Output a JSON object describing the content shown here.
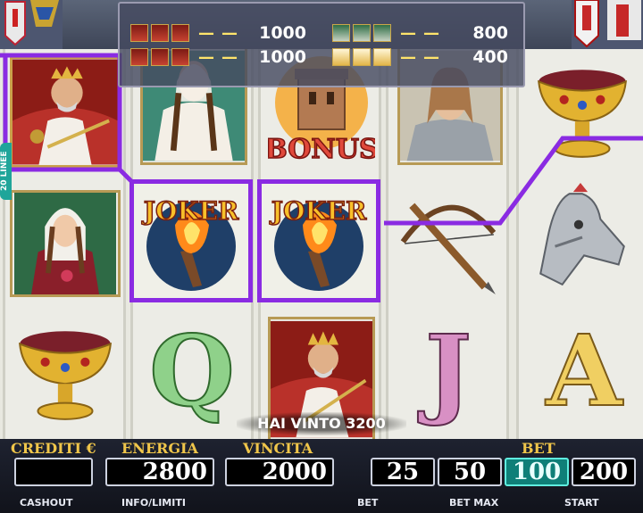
{
  "paytable": {
    "rows": [
      {
        "symbol_icon": "king-icon",
        "payout": "1000"
      },
      {
        "symbol_icon": "lady-icon",
        "payout": "800"
      },
      {
        "symbol_icon": "king-icon",
        "payout": "1000"
      },
      {
        "symbol_icon": "grail-icon",
        "payout": "400"
      }
    ]
  },
  "reels": {
    "bonus_label": "BONUS",
    "joker_label": "JOKER",
    "letters": [
      "Q",
      "J",
      "A"
    ]
  },
  "win_message": "HAI VINTO 3200",
  "panel": {
    "credits_label": "CREDITI €",
    "credits_value": "",
    "energy_label": "ENERGIA",
    "energy_value": "2800",
    "win_label": "VINCITA",
    "win_value": "2000",
    "bet_label": "BET",
    "bet_options": [
      "25",
      "50",
      "100",
      "200"
    ],
    "bet_selected": "100"
  },
  "buttons": {
    "cashout": "CASHOUT",
    "info": "INFO/LIMITI",
    "bet": "BET",
    "bet_max": "BET MAX",
    "start": "START"
  },
  "side_tab": "20 LINEE",
  "colors": {
    "payline": "#8a2be2",
    "accent_gold": "#f0c64a",
    "bet_active": "#0f7f78"
  }
}
